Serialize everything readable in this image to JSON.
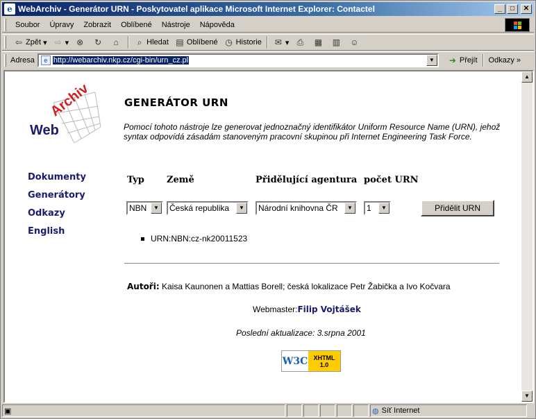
{
  "window": {
    "title": "WebArchiv - Generátor URN - Poskytovatel aplikace Microsoft Internet Explorer: Contactel",
    "min": "_",
    "max": "□",
    "close": "✕"
  },
  "menu": [
    "Soubor",
    "Úpravy",
    "Zobrazit",
    "Oblíbené",
    "Nástroje",
    "Nápověda"
  ],
  "toolbar": {
    "back": "Zpět",
    "search": "Hledat",
    "favorites": "Oblíbené",
    "history": "Historie"
  },
  "address": {
    "label": "Adresa",
    "url": "http://webarchiv.nkp.cz/cgi-bin/urn_cz.pl",
    "go": "Přejít",
    "links": "Odkazy"
  },
  "logo": {
    "web": "Web",
    "archiv": "Archiv"
  },
  "sidebar": [
    "Dokumenty",
    "Generátory",
    "Odkazy",
    "English"
  ],
  "page": {
    "title": "GENERÁTOR URN",
    "intro": "Pomocí tohoto nástroje lze generovat jednoznačný identifikátor Uniform Resource Name (URN), jehož syntax odpovídá zásadám stanoveným pracovní skupinou při Internet Engineering Task Force.",
    "labels": {
      "typ": "Typ",
      "zeme": "Země",
      "agentura": "Přidělující agentura",
      "pocet": "počet URN"
    },
    "selects": {
      "typ": "NBN",
      "zeme": "Česká republika",
      "agentura": "Národní knihovna ČR",
      "pocet": "1"
    },
    "button": "Přidělit URN",
    "result": "URN:NBN:cz-nk20011523",
    "authors_label": "Autoři:",
    "authors": "Kaisa Kaunonen a Mattias Borell; česká lokalizace Petr Žabička a Ivo Kočvara",
    "webmaster_label": "Webmaster:",
    "webmaster": "Filip Vojtášek",
    "updated": "Poslední aktualizace: 3.srpna 2001",
    "badge": {
      "w3c": "W3C",
      "xhtml": "XHTML",
      "ver": "1.0"
    }
  },
  "status": {
    "zone": "Síť Internet"
  },
  "colors": {
    "title_start": "#0a246a",
    "link": "#1a1a6e",
    "logo_red": "#cc2222"
  }
}
